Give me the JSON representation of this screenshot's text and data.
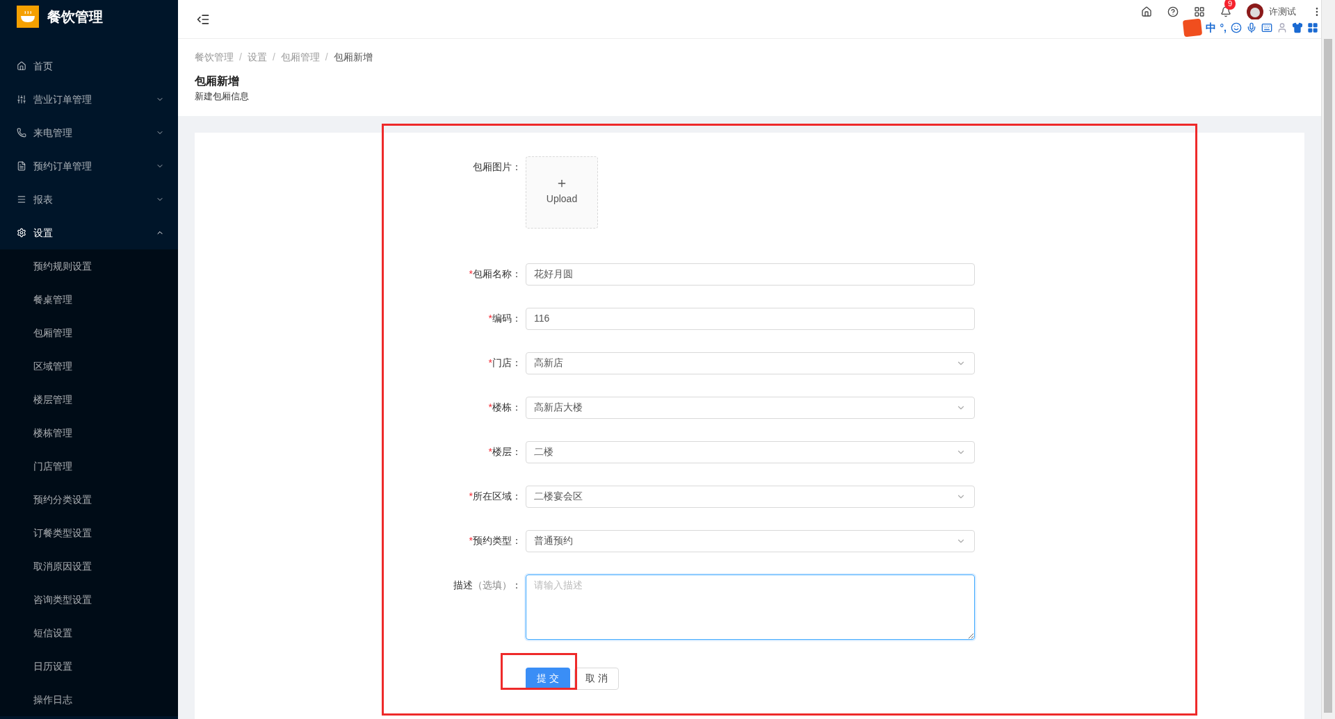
{
  "sidebar": {
    "logo_title": "餐饮管理",
    "items": [
      {
        "label": "首页",
        "expandable": false
      },
      {
        "label": "营业订单管理",
        "expandable": true,
        "expanded": false
      },
      {
        "label": "来电管理",
        "expandable": true,
        "expanded": false
      },
      {
        "label": "预约订单管理",
        "expandable": true,
        "expanded": false
      },
      {
        "label": "报表",
        "expandable": true,
        "expanded": false
      },
      {
        "label": "设置",
        "expandable": true,
        "expanded": true,
        "children": [
          {
            "label": "预约规则设置"
          },
          {
            "label": "餐桌管理"
          },
          {
            "label": "包厢管理"
          },
          {
            "label": "区域管理"
          },
          {
            "label": "楼层管理"
          },
          {
            "label": "楼栋管理"
          },
          {
            "label": "门店管理"
          },
          {
            "label": "预约分类设置"
          },
          {
            "label": "订餐类型设置"
          },
          {
            "label": "取消原因设置"
          },
          {
            "label": "咨询类型设置"
          },
          {
            "label": "短信设置"
          },
          {
            "label": "日历设置"
          },
          {
            "label": "操作日志"
          }
        ]
      }
    ]
  },
  "header": {
    "notification_count": "9",
    "user_name": "许测试"
  },
  "ime_toolbar": {
    "mode": "中",
    "punct": "°,"
  },
  "breadcrumb": [
    {
      "label": "餐饮管理"
    },
    {
      "separator": "/",
      "label": "设置"
    },
    {
      "separator": "/",
      "label": "包厢管理"
    },
    {
      "separator": "/",
      "label": "包厢新增"
    }
  ],
  "page_title": "包厢新增",
  "page_subtitle": "新建包厢信息",
  "form": {
    "fields": [
      {
        "kind": "upload",
        "label": "包厢图片",
        "colon": "：",
        "upload_text": "Upload"
      },
      {
        "kind": "input",
        "required_mark": "*",
        "label": "包厢名称",
        "colon": "：",
        "value": "花好月圆"
      },
      {
        "kind": "input",
        "required_mark": "*",
        "label": "编码",
        "colon": "：",
        "value": "116"
      },
      {
        "kind": "select",
        "required_mark": "*",
        "label": "门店",
        "colon": "：",
        "value": "高新店"
      },
      {
        "kind": "select",
        "required_mark": "*",
        "label": "楼栋",
        "colon": "：",
        "value": "高新店大楼"
      },
      {
        "kind": "select",
        "required_mark": "*",
        "label": "楼层",
        "colon": "：",
        "value": "二楼"
      },
      {
        "kind": "select",
        "required_mark": "*",
        "label": "所在区域",
        "colon": "：",
        "value": "二楼宴会区"
      },
      {
        "kind": "select",
        "required_mark": "*",
        "label": "预约类型",
        "colon": "：",
        "value": "普通预约"
      },
      {
        "kind": "textarea",
        "label": "描述",
        "note": "（选填）",
        "colon": "：",
        "placeholder": "请输入描述"
      }
    ],
    "buttons": [
      {
        "label": "提 交",
        "kind": "primary"
      },
      {
        "label": "取 消",
        "kind": "default"
      }
    ]
  }
}
